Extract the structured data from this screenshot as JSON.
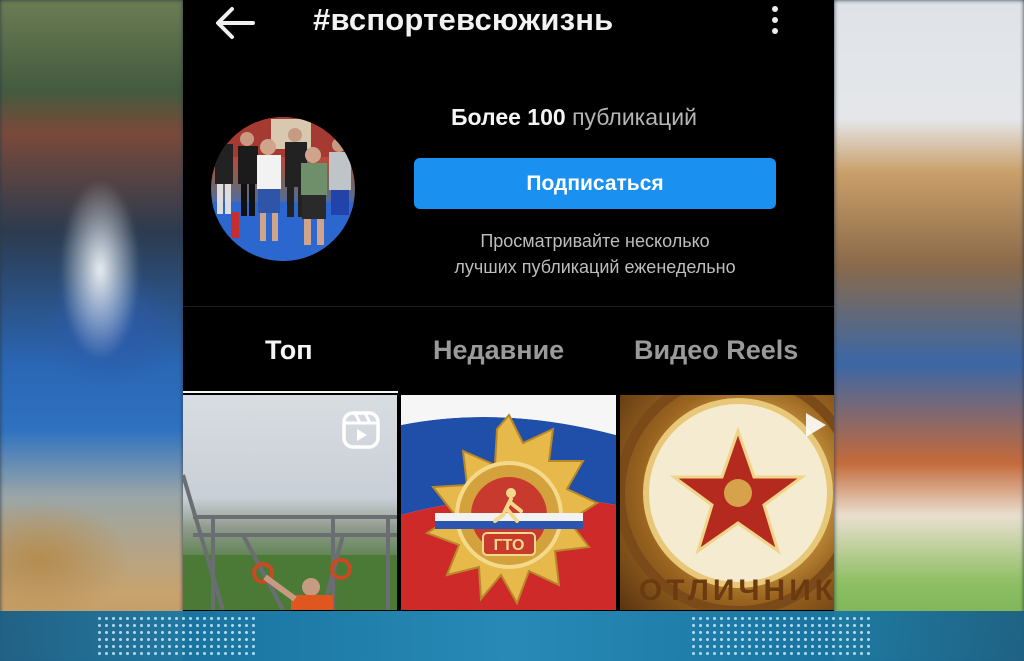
{
  "header": {
    "hashtag": "#вспортевсюжизнь",
    "back_icon": "arrow-left-icon",
    "more_icon": "more-vertical-icon"
  },
  "profile": {
    "publications_count": "Более 100",
    "publications_label": "публикаций",
    "subscribe_label": "Подписаться",
    "hint_line1": "Просматривайте несколько",
    "hint_line2": "лучших публикаций еженедельно"
  },
  "tabs": [
    {
      "label": "Топ",
      "active": true
    },
    {
      "label": "Недавние",
      "active": false
    },
    {
      "label": "Видео Reels",
      "active": false
    }
  ],
  "grid": {
    "tile3_text": "ОТЛИЧНИК",
    "tile2_badge_text": "ГТО",
    "reels_icon": "reels-icon"
  },
  "colors": {
    "accent_button": "#1a90f0",
    "background": "#000000",
    "tab_active": "#f5f5f5",
    "tab_inactive": "#9a9a9a"
  }
}
